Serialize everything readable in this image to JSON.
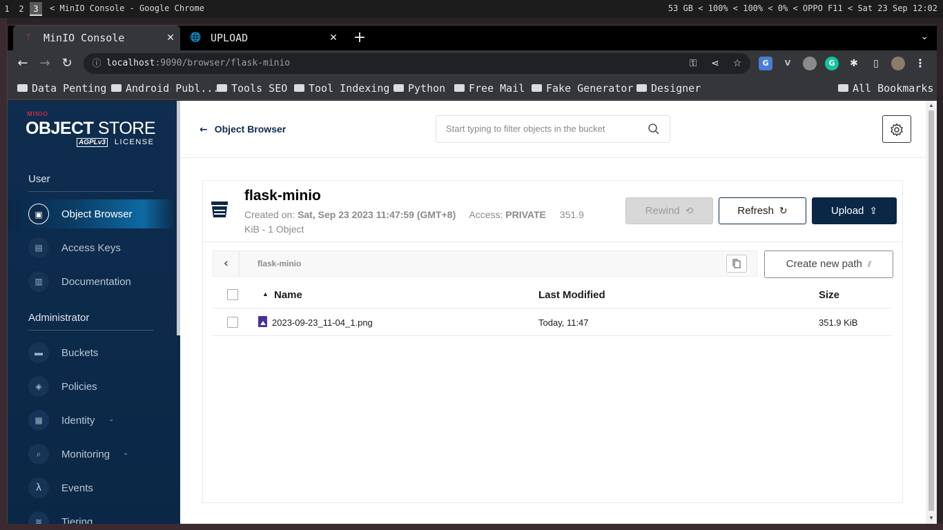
{
  "system_bar": {
    "workspaces": [
      "1",
      "2",
      "3"
    ],
    "active_workspace": "3",
    "window_title": "< MinIO Console - Google Chrome",
    "status": "53 GB < 100% < 100% < 0% < OPPO F11 < Sat 23 Sep 12:02"
  },
  "browser": {
    "tabs": [
      {
        "title": "MinIO Console",
        "close": "✕"
      },
      {
        "title": "UPLOAD",
        "close": "✕"
      }
    ],
    "new_tab": "+",
    "address": {
      "host": "localhost",
      "rest": ":9090/browser/flask-minio"
    },
    "bookmarks": [
      "Data Penting",
      "Android Publ...",
      "Tools SEO",
      "Tool Indexing",
      "Python",
      "Free Mail",
      "Fake Generator",
      "Designer"
    ],
    "all_bookmarks": "All Bookmarks"
  },
  "sidebar": {
    "logo_small": "MINIO",
    "logo_main_bold": "OBJECT",
    "logo_main_light": " STORE",
    "logo_badge": "AGPLv3",
    "logo_license": "LICENSE",
    "section_user": "User",
    "section_admin": "Administrator",
    "user_items": [
      {
        "label": "Object Browser",
        "active": true
      },
      {
        "label": "Access Keys"
      },
      {
        "label": "Documentation"
      }
    ],
    "admin_items": [
      {
        "label": "Buckets"
      },
      {
        "label": "Policies"
      },
      {
        "label": "Identity",
        "expandable": true
      },
      {
        "label": "Monitoring",
        "expandable": true
      },
      {
        "label": "Events"
      },
      {
        "label": "Tiering"
      }
    ]
  },
  "topbar": {
    "back_label": "Object Browser",
    "search_placeholder": "Start typing to filter objects in the bucket"
  },
  "bucket": {
    "name": "flask-minio",
    "created_label": "Created on:",
    "created_value": "Sat, Sep 23 2023 11:47:59 (GMT+8)",
    "access_label": "Access:",
    "access_value": "PRIVATE",
    "size_summary_a": "351.9",
    "size_summary_b": "KiB - 1 Object",
    "rewind_label": "Rewind",
    "refresh_label": "Refresh",
    "upload_label": "Upload",
    "path": "flask-minio",
    "create_path_label": "Create new path"
  },
  "table": {
    "columns": [
      "Name",
      "Last Modified",
      "Size"
    ],
    "rows": [
      {
        "name": "2023-09-23_11-04_1.png",
        "modified": "Today, 11:47",
        "size": "351.9 KiB"
      }
    ]
  },
  "colors": {
    "sidebar_bg": "#0b2746",
    "primary_button": "#0b2746",
    "brand_red": "#c72c48",
    "file_icon": "#4b2f9c"
  }
}
